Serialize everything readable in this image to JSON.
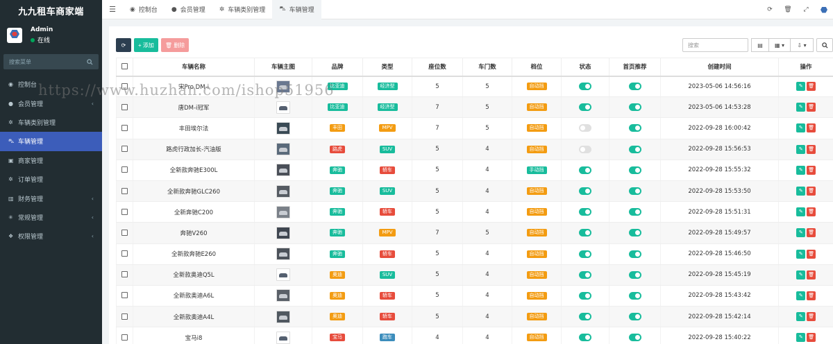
{
  "app": {
    "title": "九九租车商家端"
  },
  "user": {
    "name": "Admin",
    "status": "在线"
  },
  "sidebar": {
    "search_placeholder": "搜索菜单",
    "items": [
      {
        "label": "控制台",
        "icon": "dashboard-icon",
        "has_arrow": false,
        "active": false
      },
      {
        "label": "会员管理",
        "icon": "user-icon",
        "has_arrow": true,
        "active": false
      },
      {
        "label": "车辆类别管理",
        "icon": "cog-icon",
        "has_arrow": false,
        "active": false
      },
      {
        "label": "车辆管理",
        "icon": "car-icon",
        "has_arrow": false,
        "active": true
      },
      {
        "label": "商家管理",
        "icon": "store-icon",
        "has_arrow": false,
        "active": false
      },
      {
        "label": "订单管理",
        "icon": "gear-icon",
        "has_arrow": false,
        "active": false
      },
      {
        "label": "财务管理",
        "icon": "bank-icon",
        "has_arrow": true,
        "active": false
      },
      {
        "label": "常规管理",
        "icon": "cogs-icon",
        "has_arrow": true,
        "active": false
      },
      {
        "label": "权限管理",
        "icon": "group-icon",
        "has_arrow": true,
        "active": false
      }
    ]
  },
  "tabs": [
    {
      "label": "控制台",
      "icon": "dashboard-icon",
      "active": false
    },
    {
      "label": "会员管理",
      "icon": "user-icon",
      "active": false
    },
    {
      "label": "车辆类别管理",
      "icon": "cog-icon",
      "active": false
    },
    {
      "label": "车辆管理",
      "icon": "car-icon",
      "active": true
    }
  ],
  "toolbar": {
    "add_label": "添加",
    "delete_label": "删除",
    "search_placeholder": "搜索"
  },
  "colors": {
    "primary": "#18bc9c",
    "danger": "#e74c3c",
    "sidebar": "#222d32",
    "active_menu": "#3c5dba",
    "warning": "#f39c12",
    "info": "#3c8dbc"
  },
  "table": {
    "columns": [
      "车辆名称",
      "车辆主图",
      "品牌",
      "类型",
      "座位数",
      "车门数",
      "档位",
      "状态",
      "首页推荐",
      "创建时间",
      "操作"
    ],
    "rows": [
      {
        "name": "宋Pro DM-i",
        "brand": "比亚迪",
        "brand_color": "#18bc9c",
        "type": "经济型",
        "type_color": "#18bc9c",
        "seats": "5",
        "doors": "5",
        "gear": "自动挡",
        "gear_color": "#f39c12",
        "status": true,
        "recommend": true,
        "created": "2023-05-06 14:56:16",
        "thumb": "#6a7890"
      },
      {
        "name": "唐DM-i冠军",
        "brand": "比亚迪",
        "brand_color": "#18bc9c",
        "type": "经济型",
        "type_color": "#18bc9c",
        "seats": "7",
        "doors": "5",
        "gear": "自动挡",
        "gear_color": "#f39c12",
        "status": true,
        "recommend": true,
        "created": "2023-05-06 14:53:28",
        "thumb": "#ffffff"
      },
      {
        "name": "丰田埃尔法",
        "brand": "丰田",
        "brand_color": "#f39c12",
        "type": "MPV",
        "type_color": "#f39c12",
        "seats": "7",
        "doors": "5",
        "gear": "自动挡",
        "gear_color": "#f39c12",
        "status": false,
        "recommend": true,
        "created": "2022-09-28 16:00:42",
        "thumb": "#3a4a55"
      },
      {
        "name": "路虎行政加长-汽油版",
        "brand": "路虎",
        "brand_color": "#e74c3c",
        "type": "SUV",
        "type_color": "#18bc9c",
        "seats": "5",
        "doors": "4",
        "gear": "自动挡",
        "gear_color": "#f39c12",
        "status": false,
        "recommend": true,
        "created": "2022-09-28 15:56:53",
        "thumb": "#5a6a7a"
      },
      {
        "name": "全新款奔驰E300L",
        "brand": "奔驰",
        "brand_color": "#18bc9c",
        "type": "轿车",
        "type_color": "#e74c3c",
        "seats": "5",
        "doors": "4",
        "gear": "手动挡",
        "gear_color": "#18bc9c",
        "status": true,
        "recommend": true,
        "created": "2022-09-28 15:55:32",
        "thumb": "#4a4f58"
      },
      {
        "name": "全新款奔驰GLC260",
        "brand": "奔驰",
        "brand_color": "#18bc9c",
        "type": "SUV",
        "type_color": "#18bc9c",
        "seats": "5",
        "doors": "4",
        "gear": "自动挡",
        "gear_color": "#f39c12",
        "status": true,
        "recommend": true,
        "created": "2022-09-28 15:53:50",
        "thumb": "#555b62"
      },
      {
        "name": "全新奔驰C200",
        "brand": "奔驰",
        "brand_color": "#18bc9c",
        "type": "轿车",
        "type_color": "#e74c3c",
        "seats": "5",
        "doors": "4",
        "gear": "自动挡",
        "gear_color": "#f39c12",
        "status": true,
        "recommend": true,
        "created": "2022-09-28 15:51:31",
        "thumb": "#7a8088"
      },
      {
        "name": "奔驰V260",
        "brand": "奔驰",
        "brand_color": "#18bc9c",
        "type": "MPV",
        "type_color": "#f39c12",
        "seats": "7",
        "doors": "5",
        "gear": "自动挡",
        "gear_color": "#f39c12",
        "status": true,
        "recommend": true,
        "created": "2022-09-28 15:49:57",
        "thumb": "#3f4650"
      },
      {
        "name": "全新款奔驰E260",
        "brand": "奔驰",
        "brand_color": "#18bc9c",
        "type": "轿车",
        "type_color": "#e74c3c",
        "seats": "5",
        "doors": "4",
        "gear": "自动挡",
        "gear_color": "#f39c12",
        "status": true,
        "recommend": true,
        "created": "2022-09-28 15:46:50",
        "thumb": "#4c525a"
      },
      {
        "name": "全新款奥迪Q5L",
        "brand": "奥迪",
        "brand_color": "#f39c12",
        "type": "SUV",
        "type_color": "#18bc9c",
        "seats": "5",
        "doors": "4",
        "gear": "自动挡",
        "gear_color": "#f39c12",
        "status": true,
        "recommend": true,
        "created": "2022-09-28 15:45:19",
        "thumb": "#ffffff"
      },
      {
        "name": "全新款奥迪A6L",
        "brand": "奥迪",
        "brand_color": "#f39c12",
        "type": "轿车",
        "type_color": "#e74c3c",
        "seats": "5",
        "doors": "4",
        "gear": "自动挡",
        "gear_color": "#f39c12",
        "status": true,
        "recommend": true,
        "created": "2022-09-28 15:43:42",
        "thumb": "#5a6068"
      },
      {
        "name": "全新款奥迪A4L",
        "brand": "奥迪",
        "brand_color": "#f39c12",
        "type": "轿车",
        "type_color": "#e74c3c",
        "seats": "5",
        "doors": "4",
        "gear": "自动挡",
        "gear_color": "#f39c12",
        "status": true,
        "recommend": true,
        "created": "2022-09-28 15:42:14",
        "thumb": "#505860"
      },
      {
        "name": "宝马i8",
        "brand": "宝马",
        "brand_color": "#e74c3c",
        "type": "跑车",
        "type_color": "#3c8dbc",
        "seats": "4",
        "doors": "4",
        "gear": "自动挡",
        "gear_color": "#f39c12",
        "status": true,
        "recommend": true,
        "created": "2022-09-28 15:40:22",
        "thumb": "#ffffff"
      }
    ]
  },
  "watermark": "https://www.huzhan.com/ishop51956"
}
